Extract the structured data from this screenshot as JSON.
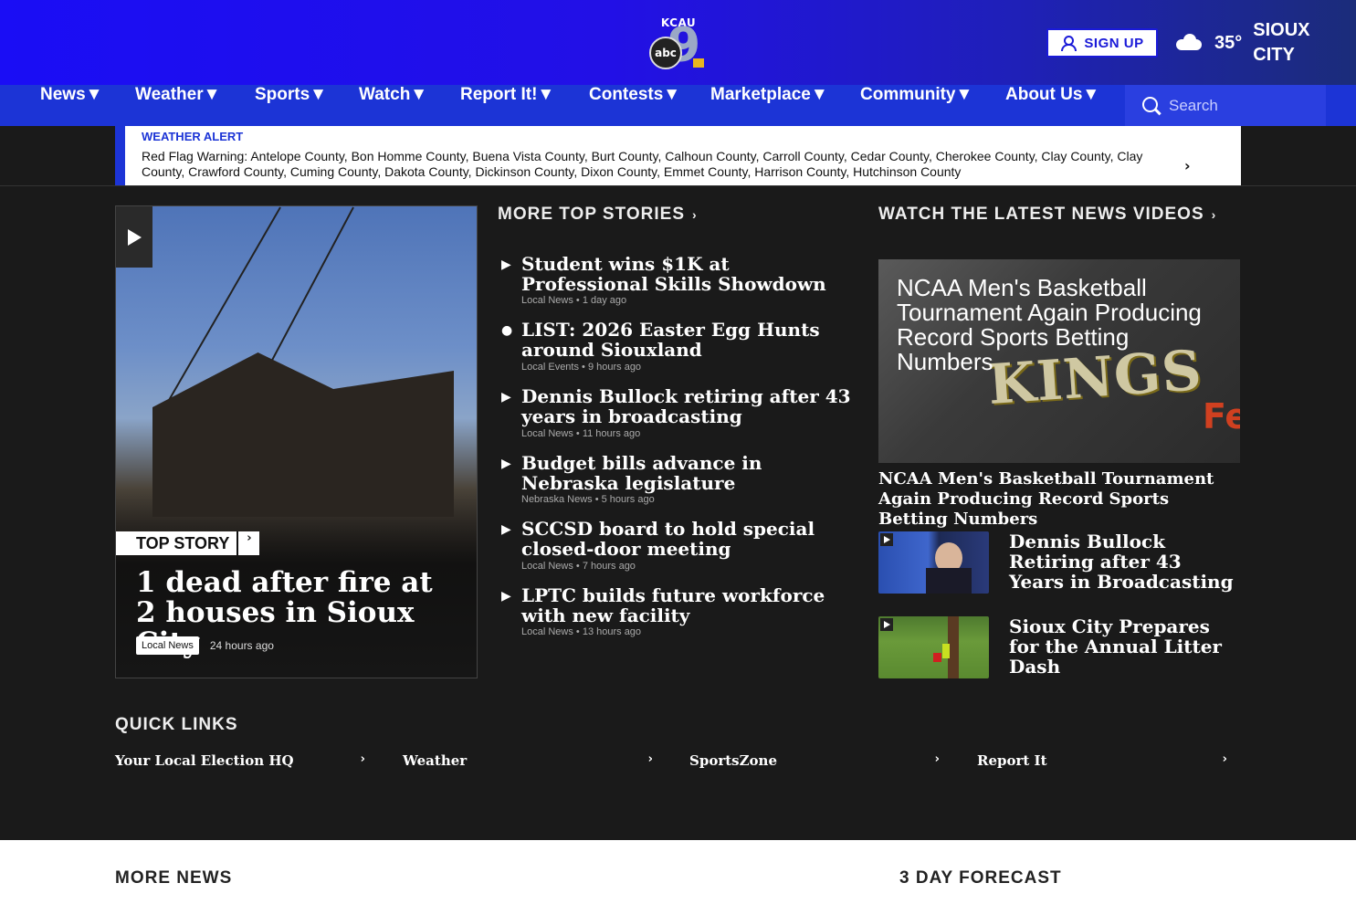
{
  "header": {
    "logo_top": "KCAU",
    "logo_abc": "abc",
    "logo_number": "9",
    "signup_label": "SIGN UP",
    "temperature": "35°",
    "city": "SIOUX CITY"
  },
  "nav": {
    "items": [
      "News▼",
      "Weather▼",
      "Sports▼",
      "Watch▼",
      "Report It!▼",
      "Contests▼",
      "Marketplace▼",
      "Community▼",
      "About Us▼"
    ],
    "search_placeholder": "Search"
  },
  "alert": {
    "title": "WEATHER ALERT",
    "text": "Red Flag Warning: Antelope County, Bon Homme County, Buena Vista County, Burt County, Calhoun County, Carroll County, Cedar County, Cherokee County, Clay County, Clay County, Crawford County, Cuming County, Dakota County, Dickinson County, Dixon County, Emmet County, Harrison County, Hutchinson County"
  },
  "top_story": {
    "label": "TOP STORY",
    "title": "1 dead after fire at 2 houses in Sioux City",
    "tag": "Local News",
    "time": "24 hours ago"
  },
  "more_top_stories": {
    "heading": "MORE TOP STORIES",
    "items": [
      {
        "bullet": "▶",
        "title": "Student wins $1K at Professional Skills Showdown",
        "category": "Local News",
        "time": "1 day ago"
      },
      {
        "bullet": "●",
        "title": "LIST: 2026 Easter Egg Hunts around Siouxland",
        "category": "Local Events",
        "time": "9 hours ago"
      },
      {
        "bullet": "▶",
        "title": "Dennis Bullock retiring after 43 years in broadcasting",
        "category": "Local News",
        "time": "11 hours ago"
      },
      {
        "bullet": "▶",
        "title": "Budget bills advance in Nebraska legislature",
        "category": "Nebraska News",
        "time": "5 hours ago"
      },
      {
        "bullet": "▶",
        "title": "SCCSD board to hold special closed-door meeting",
        "category": "Local News",
        "time": "7 hours ago"
      },
      {
        "bullet": "▶",
        "title": "LPTC builds future workforce with new facility",
        "category": "Local News",
        "time": "13 hours ago"
      }
    ]
  },
  "videos": {
    "heading": "WATCH THE LATEST NEWS VIDEOS",
    "featured_overlay": "NCAA Men's Basketball Tournament Again Producing Record Sports Betting Numbers",
    "featured_title": "NCAA Men's Basketball Tournament Again Producing Record Sports Betting Numbers",
    "items": [
      {
        "title": "Dennis Bullock Retiring after 43 Years in Broadcasting"
      },
      {
        "title": "Sioux City Prepares for the Annual Litter Dash"
      }
    ]
  },
  "quick_links": {
    "heading": "QUICK LINKS",
    "items": [
      "Your Local Election HQ",
      "Weather",
      "SportsZone",
      "Report It"
    ]
  },
  "bottom": {
    "more_news": "MORE NEWS",
    "forecast": "3 DAY FORECAST"
  },
  "colors": {
    "accent": "#1c34d6",
    "header_gradient_start": "#1a0df5",
    "dark_bg": "#1a1a1a"
  },
  "icons": [
    "user-icon",
    "cloud-icon",
    "search-icon",
    "play-icon",
    "chevron-right-icon"
  ]
}
